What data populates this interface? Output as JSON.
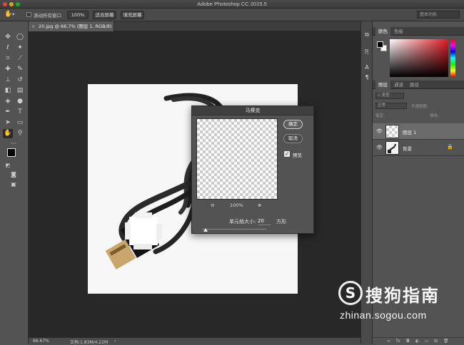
{
  "app": {
    "title": "Adobe Photoshop CC 2015.5"
  },
  "options_bar": {
    "scroll_all_label": "滚动所有窗口",
    "zoom_label": "100%",
    "fit_screen_label": "适合屏幕",
    "fill_screen_label": "填充屏幕",
    "workspace_label": "基本功能"
  },
  "document": {
    "tab_label": "20.jpg @ 66.7% (图层 1, RGB/8) *"
  },
  "status": {
    "zoom": "66.67%",
    "doc_size": "文档:1.83M/4.22M"
  },
  "panels": {
    "color_tabs": [
      "颜色",
      "色板"
    ],
    "layer_tabs": [
      "图层",
      "通道",
      "路径"
    ],
    "kind_filter": "类型",
    "blend_mode": "正常",
    "opacity_label": "不透明度:",
    "lock_label": "锁定:",
    "fill_label": "填充:",
    "layers": [
      {
        "name": "图层 1",
        "selected": true
      },
      {
        "name": "背景",
        "selected": false
      }
    ]
  },
  "dialog": {
    "title": "马赛克",
    "ok_label": "确定",
    "cancel_label": "取消",
    "preview_label": "预览",
    "preview_checked": true,
    "zoom_value": "100%",
    "cell_size_label": "单元格大小:",
    "cell_size_value": "20",
    "unit_label": "方形"
  },
  "watermark": {
    "symbol": "S",
    "brand_cn": "搜狗指南",
    "url": "zhinan.sogou.com"
  },
  "colors": {
    "accent_blue": "#4a90d9",
    "panel_bg": "#535353",
    "canvas_bg": "#282828"
  }
}
